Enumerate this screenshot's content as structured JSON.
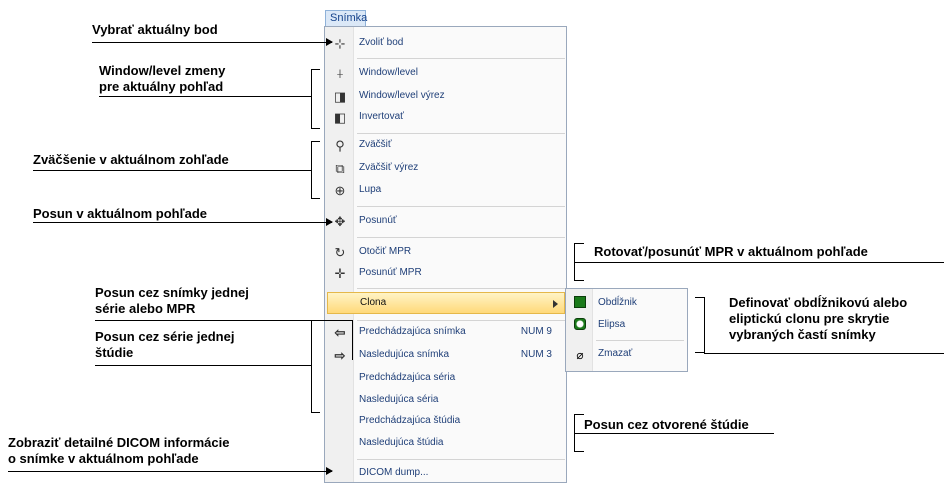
{
  "menu": {
    "tab_label": "Snímka",
    "items": [
      {
        "label": "Zvoliť bod",
        "icon": "cursor-point-icon",
        "glyph": "⊹"
      },
      {
        "label": "Window/level",
        "icon": "window-level-icon",
        "glyph": "⍭"
      },
      {
        "label": "Window/level výrez",
        "icon": "window-level-region-icon",
        "glyph": "◨"
      },
      {
        "label": "Invertovať",
        "icon": "invert-icon",
        "glyph": "◧"
      },
      {
        "label": "Zväčšiť",
        "icon": "zoom-icon",
        "glyph": "⚲"
      },
      {
        "label": "Zväčšiť výrez",
        "icon": "zoom-region-icon",
        "glyph": "⧉"
      },
      {
        "label": "Lupa",
        "icon": "magnifier-icon",
        "glyph": "⊕"
      },
      {
        "label": "Posunúť",
        "icon": "pan-icon",
        "glyph": "✥"
      },
      {
        "label": "Otočiť MPR",
        "icon": "rotate-mpr-icon",
        "glyph": "↻"
      },
      {
        "label": "Posunúť MPR",
        "icon": "move-mpr-icon",
        "glyph": "✛"
      },
      {
        "label": "Clona",
        "icon": "",
        "glyph": ""
      },
      {
        "label": "Predchádzajúca snímka",
        "shortcut": "NUM 9",
        "icon": "arrow-left-icon",
        "glyph": "⇦"
      },
      {
        "label": "Nasledujúca snímka",
        "shortcut": "NUM 3",
        "icon": "arrow-right-icon",
        "glyph": "⇨"
      },
      {
        "label": "Predchádzajúca séria"
      },
      {
        "label": "Nasledujúca séria"
      },
      {
        "label": "Predchádzajúca štúdia"
      },
      {
        "label": "Nasledujúca štúdia"
      },
      {
        "label": "DICOM dump..."
      }
    ]
  },
  "submenu": {
    "items": [
      {
        "label": "Obdĺžnik",
        "icon": "rectangle-shutter-icon"
      },
      {
        "label": "Elipsa",
        "icon": "ellipse-shutter-icon"
      },
      {
        "label": "Zmazať",
        "icon": "eraser-icon",
        "glyph": "⌀"
      }
    ]
  },
  "annotations": {
    "select_point": "Vybrať aktuálny bod",
    "wl_line1": "Window/level zmeny",
    "wl_line2": "pre aktuálny pohľad",
    "zoom": "Zväčšenie v aktuálnom zohľade",
    "pan": "Posun v aktuálnom pohľade",
    "rotate": "Rotovať/posunúť MPR v aktuálnom pohľade",
    "shutter_line1": "Definovať obdĺžnikovú alebo",
    "shutter_line2": "eliptickú clonu pre skrytie",
    "shutter_line3": "vybraných častí snímky",
    "images_line1": "Posun cez snímky jednej",
    "images_line2": "série alebo MPR",
    "series_line1": "Posun cez série jednej",
    "series_line2": "štúdie",
    "studies": "Posun cez otvorené štúdie",
    "dicom_line1": "Zobraziť detailné DICOM informácie",
    "dicom_line2": "o snímke v aktuálnom pohľade"
  }
}
